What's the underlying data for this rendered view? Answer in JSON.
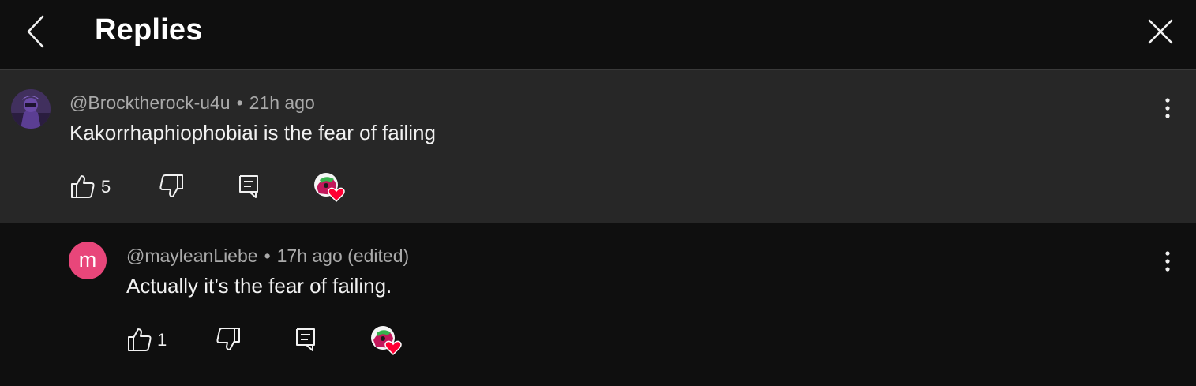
{
  "header": {
    "title": "Replies"
  },
  "parent_comment": {
    "handle": "@Brocktherock-u4u",
    "separator": "•",
    "time": "21h ago",
    "text": "Kakorrhaphiophobiai is the fear of failing",
    "likes": "5"
  },
  "reply_comment": {
    "avatar_letter": "m",
    "handle": "@mayleanLiebe",
    "separator": "•",
    "time": "17h ago (edited)",
    "text": "Actually it’s the fear of failing.",
    "likes": "1"
  },
  "colors": {
    "background": "#0f0f0f",
    "parent_background": "#272727",
    "avatar_pink": "#e8467a",
    "heart_red": "#ff0033",
    "meta_gray": "#aaaaaa"
  }
}
